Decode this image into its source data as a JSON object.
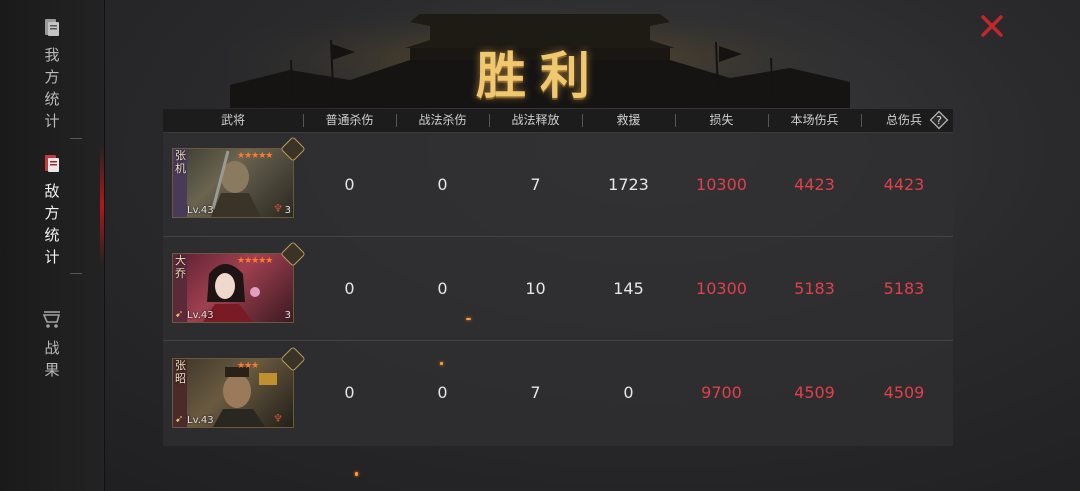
{
  "sidebar": {
    "items": [
      {
        "label": "我方统计",
        "icon": "document-icon",
        "active": false
      },
      {
        "label": "敌方统计",
        "icon": "document-icon",
        "active": true
      },
      {
        "label": "战果",
        "icon": "cart-icon",
        "active": false
      }
    ]
  },
  "banner": {
    "title": "胜利"
  },
  "table": {
    "headers": [
      "武将",
      "普通杀伤",
      "战法杀伤",
      "战法释放",
      "救援",
      "损失",
      "本场伤兵",
      "总伤兵"
    ],
    "rows": [
      {
        "name": "张机",
        "level": "Lv.43",
        "count": "3",
        "stars": "★★★★★",
        "values": [
          "0",
          "0",
          "7",
          "1723",
          "10300",
          "4423",
          "4423"
        ]
      },
      {
        "name": "大乔",
        "level": "Lv.43",
        "count": "3",
        "stars": "★★★★★",
        "values": [
          "0",
          "0",
          "10",
          "145",
          "10300",
          "5183",
          "5183"
        ]
      },
      {
        "name": "张昭",
        "level": "Lv.43",
        "count": "3",
        "stars": "★★★",
        "values": [
          "0",
          "0",
          "7",
          "0",
          "9700",
          "4509",
          "4509"
        ]
      }
    ]
  },
  "colors": {
    "loss_red": "#e0404a",
    "gold": "#f0c870",
    "accent_red": "#c0282a"
  }
}
